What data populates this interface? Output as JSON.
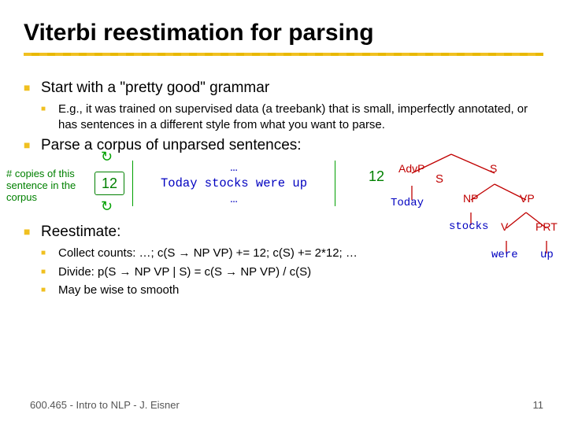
{
  "title": "Viterbi reestimation for parsing",
  "bullets": {
    "b1": "Start with a \"pretty good\" grammar",
    "b1a": "E.g., it was trained on supervised data (a treebank) that is small, imperfectly annotated, or has sentences in a different style from what you want to parse.",
    "b2": "Parse a corpus of unparsed sentences:",
    "b3": "Reestimate:",
    "b3a": "Collect counts: …; c(S → NP VP) += 12; c(S) += 2*12; …",
    "b3b": "Divide: p(S → NP VP | S) = c(S → NP VP) / c(S)",
    "b3c": "May be wise to smooth"
  },
  "copies_label": "# copies of this sentence in the corpus",
  "copies_value": "12",
  "sentence": {
    "ell": "…",
    "line": "Today stocks were up",
    "ell2": "…"
  },
  "tree": {
    "root_s_top": "S",
    "n12": "12",
    "advp": "AdvP",
    "s": "S",
    "today": "Today",
    "np": "NP",
    "vp": "VP",
    "stocks": "stocks",
    "v": "V",
    "prt": "PRT",
    "were": "were",
    "up": "up"
  },
  "footer": "600.465 - Intro to NLP - J. Eisner",
  "page": "11"
}
